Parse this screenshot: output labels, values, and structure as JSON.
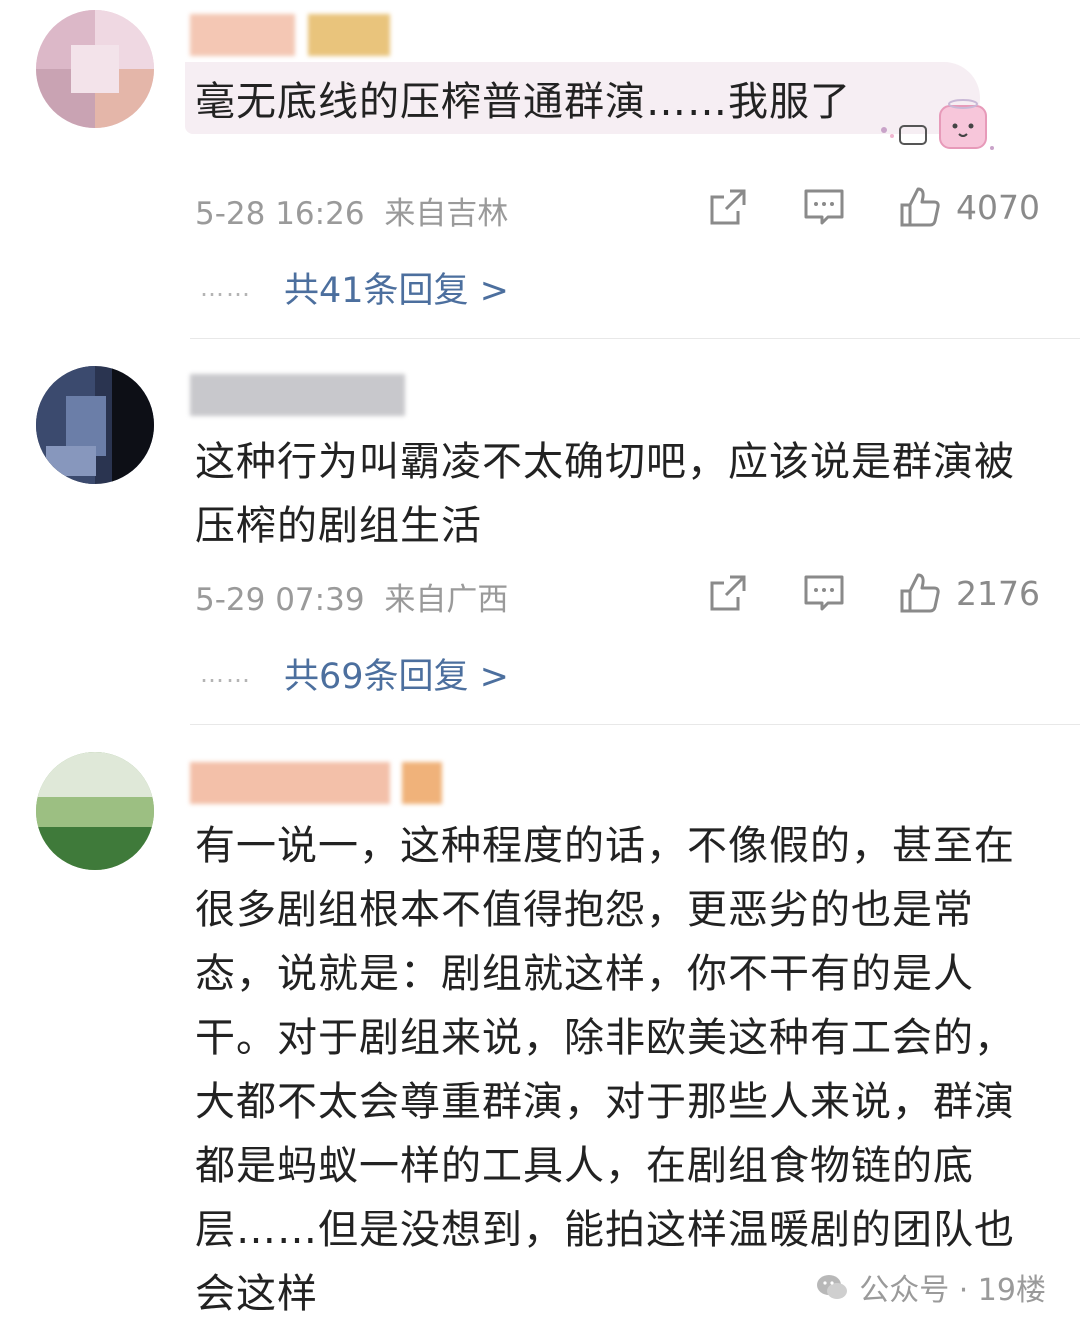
{
  "comments": [
    {
      "text": "毫无底线的压榨普通群演……我服了",
      "date": "5-28 16:26",
      "location": "来自吉林",
      "likes": "4070",
      "replies": "共41条回复 >",
      "dots": "……"
    },
    {
      "text": "这种行为叫霸凌不太确切吧，应该说是群演被压榨的剧组生活",
      "date": "5-29 07:39",
      "location": "来自广西",
      "likes": "2176",
      "replies": "共69条回复 >",
      "dots": "……"
    },
    {
      "text": "有一说一，这种程度的话，不像假的，甚至在很多剧组根本不值得抱怨，更恶劣的也是常态，说就是：剧组就这样，你不干有的是人干。对于剧组来说，除非欧美这种有工会的，大都不太会尊重群演，对于那些人来说，群演都是蚂蚁一样的工具人，在剧组食物链的底层……但是没想到，能拍这样温暖剧的团队也会这样"
    }
  ],
  "watermark": {
    "text": "公众号 · 19楼"
  },
  "colors": {
    "reply_link": "#4c6f9e",
    "meta": "#9a9a9a",
    "bubble": "#f6eef3"
  }
}
